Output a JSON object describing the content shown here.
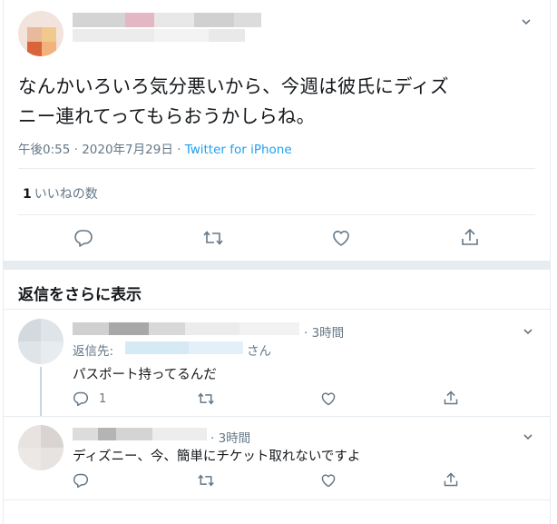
{
  "tweet": {
    "text_line1": "なんかいろいろ気分悪いから、今週は彼氏にディズ",
    "text_line2": "ニー連れてってもらおうかしらね。",
    "timestamp": "午後0:55 · 2020年7月29日 · ",
    "source": "Twitter for iPhone",
    "like_count": "1",
    "like_label": "いいねの数",
    "actions": [
      "reply-icon",
      "retweet-icon",
      "like-icon",
      "share-icon"
    ]
  },
  "show_more_replies": "返信をさらに表示",
  "replies": [
    {
      "time": "· 3時間",
      "reply_to_prefix": "返信先:",
      "reply_to_suffix": "さん",
      "text": "パスポート持ってるんだ",
      "reply_count": "1"
    },
    {
      "time": "· 3時間",
      "text": "ディズニー、今、簡単にチケット取れないですよ"
    }
  ],
  "colors": {
    "accent": "#1da1f2",
    "secondary_text": "#657786",
    "divider": "#e6ecf0"
  }
}
